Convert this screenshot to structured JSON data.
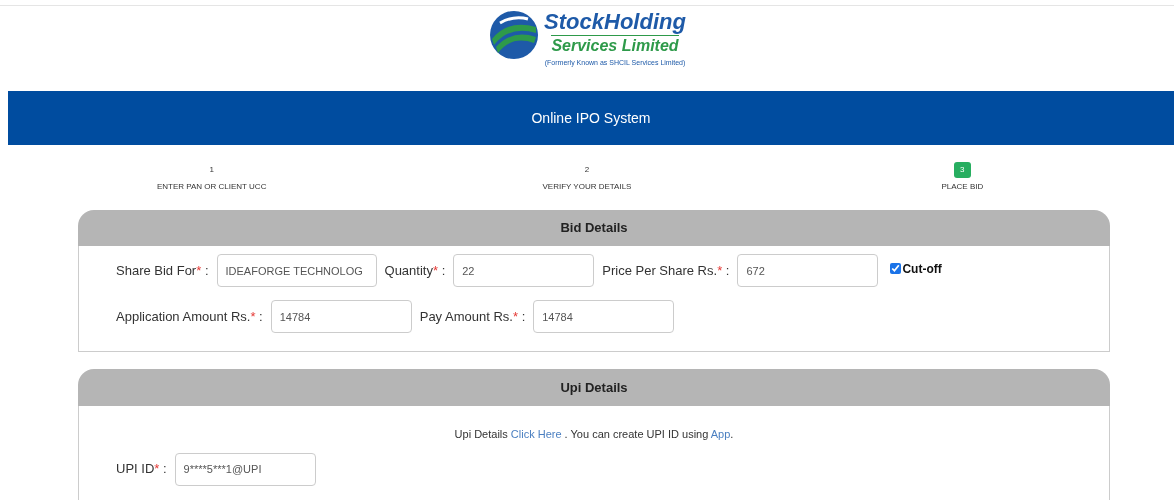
{
  "logo": {
    "name": "StockHolding",
    "subtitle": "Services Limited",
    "note": "(Formerly Known as SHCIL Services Limited)"
  },
  "header": {
    "title": "Online IPO System"
  },
  "steps": [
    {
      "number": "1",
      "label": "ENTER PAN OR CLIENT UCC",
      "selected": false
    },
    {
      "number": "2",
      "label": "VERIFY YOUR DETAILS",
      "selected": false
    },
    {
      "number": "3",
      "label": "PLACE BID",
      "selected": true
    }
  ],
  "bid_details": {
    "title": "Bid Details",
    "rows": [
      [
        {
          "label": "Share Bid For",
          "required_mark": "*",
          "colon": ":",
          "value": "IDEAFORGE TECHNOLOG"
        },
        {
          "label": "Quantity",
          "required_mark": "*",
          "colon": ":",
          "value": "22"
        },
        {
          "label": "Price Per Share Rs.",
          "required_mark": "*",
          "colon": ":",
          "value": "672"
        }
      ],
      [
        {
          "label": "Application Amount Rs.",
          "required_mark": "*",
          "colon": ":",
          "value": "14784"
        },
        {
          "label": "Pay Amount Rs.",
          "required_mark": "*",
          "colon": ":",
          "value": "14784"
        }
      ]
    ],
    "cutoff": {
      "label": "Cut-off",
      "checked": true
    }
  },
  "upi_details": {
    "title": "Upi Details",
    "info": [
      {
        "kind": "text",
        "text": "Upi Details "
      },
      {
        "kind": "link",
        "text": "Click Here"
      },
      {
        "kind": "text",
        "text": " . You can create UPI ID using "
      },
      {
        "kind": "link",
        "text": "App"
      },
      {
        "kind": "text",
        "text": "."
      }
    ],
    "field": {
      "label": "UPI ID",
      "required_mark": "*",
      "colon": ":",
      "value": "9****5***1@UPI"
    }
  }
}
